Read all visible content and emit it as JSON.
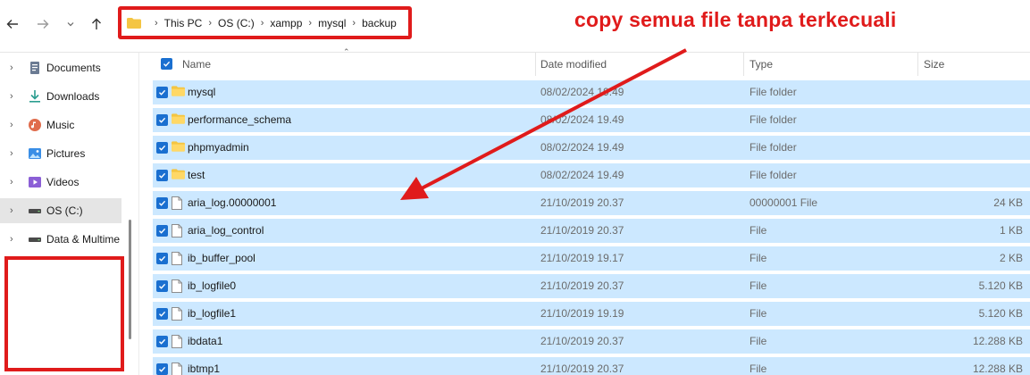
{
  "breadcrumb": [
    "This PC",
    "OS (C:)",
    "xampp",
    "mysql",
    "backup"
  ],
  "annotation": "copy semua file tanpa terkecuali",
  "sidebar": {
    "items": [
      {
        "label": "Documents",
        "icon": "documents-icon"
      },
      {
        "label": "Downloads",
        "icon": "downloads-icon"
      },
      {
        "label": "Music",
        "icon": "music-icon"
      },
      {
        "label": "Pictures",
        "icon": "pictures-icon"
      },
      {
        "label": "Videos",
        "icon": "videos-icon"
      },
      {
        "label": "OS (C:)",
        "icon": "drive-icon",
        "selected": true
      },
      {
        "label": "Data & Multime",
        "icon": "drive-icon"
      }
    ]
  },
  "columns": {
    "name": "Name",
    "date": "Date modified",
    "type": "Type",
    "size": "Size"
  },
  "files": [
    {
      "name": "mysql",
      "date": "08/02/2024 19.49",
      "type": "File folder",
      "size": "",
      "kind": "folder"
    },
    {
      "name": "performance_schema",
      "date": "08/02/2024 19.49",
      "type": "File folder",
      "size": "",
      "kind": "folder"
    },
    {
      "name": "phpmyadmin",
      "date": "08/02/2024 19.49",
      "type": "File folder",
      "size": "",
      "kind": "folder"
    },
    {
      "name": "test",
      "date": "08/02/2024 19.49",
      "type": "File folder",
      "size": "",
      "kind": "folder"
    },
    {
      "name": "aria_log.00000001",
      "date": "21/10/2019 20.37",
      "type": "00000001 File",
      "size": "24 KB",
      "kind": "file"
    },
    {
      "name": "aria_log_control",
      "date": "21/10/2019 20.37",
      "type": "File",
      "size": "1 KB",
      "kind": "file"
    },
    {
      "name": "ib_buffer_pool",
      "date": "21/10/2019 19.17",
      "type": "File",
      "size": "2 KB",
      "kind": "file"
    },
    {
      "name": "ib_logfile0",
      "date": "21/10/2019 20.37",
      "type": "File",
      "size": "5.120 KB",
      "kind": "file"
    },
    {
      "name": "ib_logfile1",
      "date": "21/10/2019 19.19",
      "type": "File",
      "size": "5.120 KB",
      "kind": "file"
    },
    {
      "name": "ibdata1",
      "date": "21/10/2019 20.37",
      "type": "File",
      "size": "12.288 KB",
      "kind": "file"
    },
    {
      "name": "ibtmp1",
      "date": "21/10/2019 20.37",
      "type": "File",
      "size": "12.288 KB",
      "kind": "file"
    }
  ],
  "colors": {
    "accent": "#1a6fd0",
    "selection": "#cce8ff",
    "annotation_red": "#e01b1b",
    "folder": "#f4c542"
  }
}
